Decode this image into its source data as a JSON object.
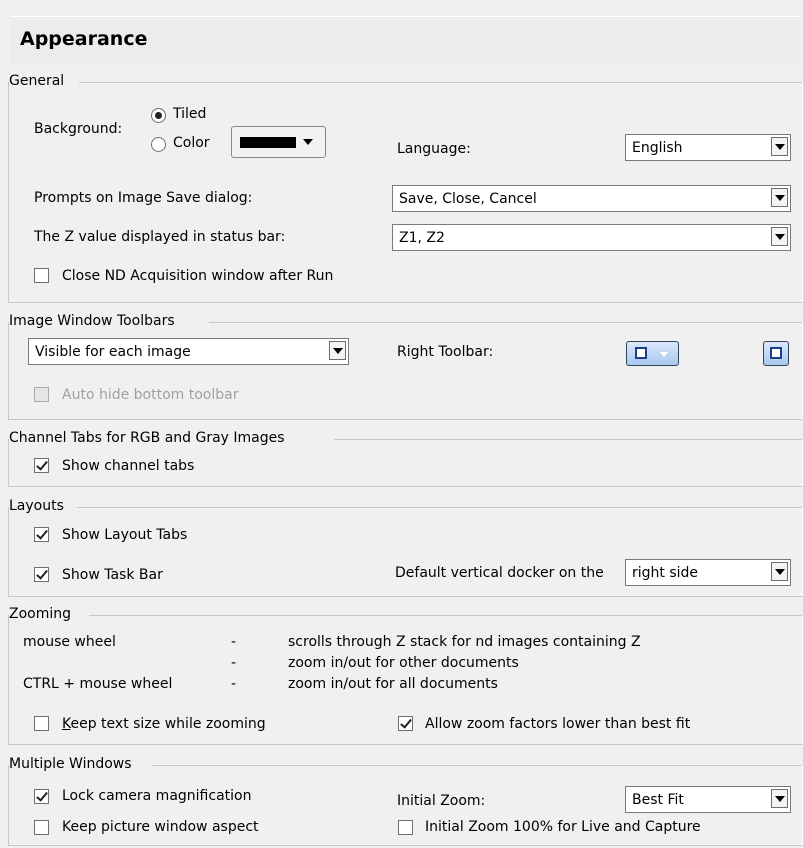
{
  "header": {
    "title": "Appearance"
  },
  "general": {
    "title": "General",
    "background_label": "Background:",
    "tiled_label": "Tiled",
    "color_label": "Color",
    "language_label": "Language:",
    "language_value": "English",
    "prompts_label": "Prompts on Image Save dialog:",
    "prompts_value": "Save, Close, Cancel",
    "zvalue_label": "The Z value displayed in status bar:",
    "zvalue_value": "Z1, Z2",
    "close_nd_label": "Close ND Acquisition window after Run"
  },
  "toolbars": {
    "title": "Image Window Toolbars",
    "visibility_value": "Visible for each image",
    "right_toolbar_label": "Right Toolbar:",
    "auto_hide_label": "Auto hide bottom toolbar"
  },
  "channel_tabs": {
    "title": "Channel Tabs for RGB and  Gray Images",
    "show_label": "Show channel tabs"
  },
  "layouts": {
    "title": "Layouts",
    "show_layout_tabs_label": "Show Layout Tabs",
    "show_task_bar_label": "Show Task Bar",
    "docker_label": "Default vertical docker on the",
    "docker_value": "right side"
  },
  "zooming": {
    "title": "Zooming",
    "rows": [
      {
        "key": "mouse wheel",
        "dash": "-",
        "desc": "scrolls through Z stack for nd images containing Z"
      },
      {
        "key": "",
        "dash": "-",
        "desc": "zoom in/out for other documents"
      },
      {
        "key": "CTRL + mouse wheel",
        "dash": "-",
        "desc": "zoom in/out for all documents"
      }
    ],
    "keep_text_k": "K",
    "keep_text_rest": "eep text size while zooming",
    "allow_lower_label": "Allow zoom factors lower than best fit"
  },
  "multiple": {
    "title": "Multiple Windows",
    "lock_label": "Lock camera magnification",
    "keep_aspect_label": "Keep picture window aspect",
    "initial_zoom_label": "Initial Zoom:",
    "initial_zoom_value": "Best Fit",
    "initial_100_label": "Initial Zoom 100% for Live and Capture"
  }
}
